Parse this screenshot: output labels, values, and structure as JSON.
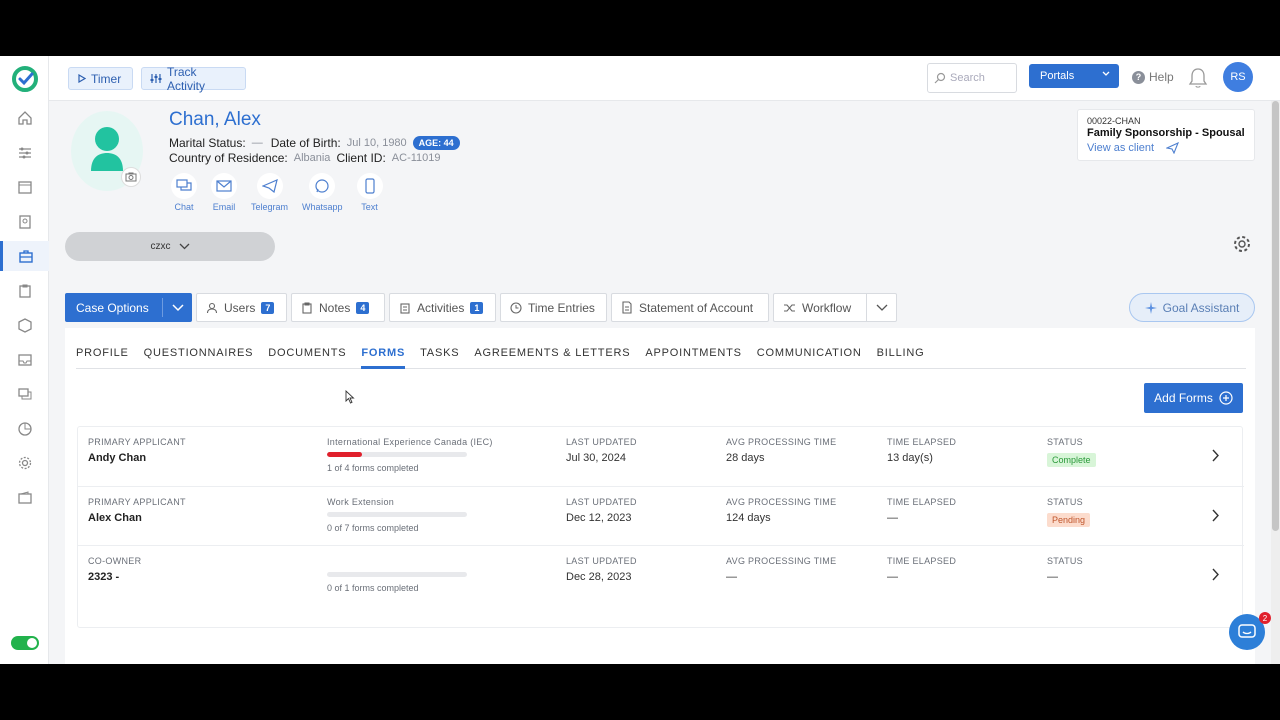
{
  "topbar": {
    "timer_label": "Timer",
    "track_label": "Track Activity",
    "search_placeholder": "Search",
    "portals_label": "Portals",
    "help_label": "Help",
    "user_initials": "RS"
  },
  "client": {
    "name": "Chan, Alex",
    "marital_status_label": "Marital Status:",
    "marital_status_value": "—",
    "dob_label": "Date of Birth:",
    "dob_value": "Jul 10, 1980",
    "age_badge": "AGE: 44",
    "country_label": "Country of Residence:",
    "country_value": "Albania",
    "client_id_label": "Client ID:",
    "client_id_value": "AC-11019"
  },
  "contacts": [
    {
      "label": "Chat",
      "icon": "chat-icon"
    },
    {
      "label": "Email",
      "icon": "email-icon"
    },
    {
      "label": "Telegram",
      "icon": "telegram-icon"
    },
    {
      "label": "Whatsapp",
      "icon": "whatsapp-icon"
    },
    {
      "label": "Text",
      "icon": "phone-icon"
    }
  ],
  "case_card": {
    "code": "00022-CHAN",
    "title": "Family Sponsorship - Spousal",
    "link": "View as client"
  },
  "case_selector": "czxc",
  "action_bar": {
    "case_options": "Case Options",
    "users": {
      "label": "Users",
      "count": "7"
    },
    "notes": {
      "label": "Notes",
      "count": "4"
    },
    "activities": {
      "label": "Activities",
      "count": "1"
    },
    "time_entries": "Time Entries",
    "statement": "Statement of Account",
    "workflow": "Workflow",
    "goal_assistant": "Goal Assistant"
  },
  "tabs": [
    "PROFILE",
    "QUESTIONNAIRES",
    "DOCUMENTS",
    "FORMS",
    "TASKS",
    "AGREEMENTS & LETTERS",
    "APPOINTMENTS",
    "COMMUNICATION",
    "BILLING"
  ],
  "active_tab": "FORMS",
  "add_forms_label": "Add Forms",
  "columns": {
    "last_updated": "LAST UPDATED",
    "avg_processing": "AVG PROCESSING TIME",
    "time_elapsed": "TIME ELAPSED",
    "status": "STATUS"
  },
  "forms": [
    {
      "role": "PRIMARY APPLICANT",
      "person": "Andy Chan",
      "program": "International Experience Canada (IEC)",
      "progress": 0.25,
      "progress_text": "1 of 4 forms completed",
      "last_updated": "Jul 30, 2024",
      "avg_processing": "28 days",
      "time_elapsed": "13 day(s)",
      "status": "Complete"
    },
    {
      "role": "PRIMARY APPLICANT",
      "person": "Alex Chan",
      "program": "Work Extension",
      "progress": 0,
      "progress_text": "0 of 7 forms completed",
      "last_updated": "Dec 12, 2023",
      "avg_processing": "124 days",
      "time_elapsed": "—",
      "status": "Pending"
    },
    {
      "role": "CO-OWNER",
      "person": "2323 -",
      "program": "",
      "progress": 0,
      "progress_text": "0 of 1 forms completed",
      "last_updated": "Dec 28, 2023",
      "avg_processing": "—",
      "time_elapsed": "—",
      "status": "—"
    }
  ],
  "chat_unread": "2",
  "colors": {
    "accent": "#2d6fd0",
    "progress": "#e0202c",
    "complete": "#2a9a3a",
    "pending": "#c0562c"
  }
}
